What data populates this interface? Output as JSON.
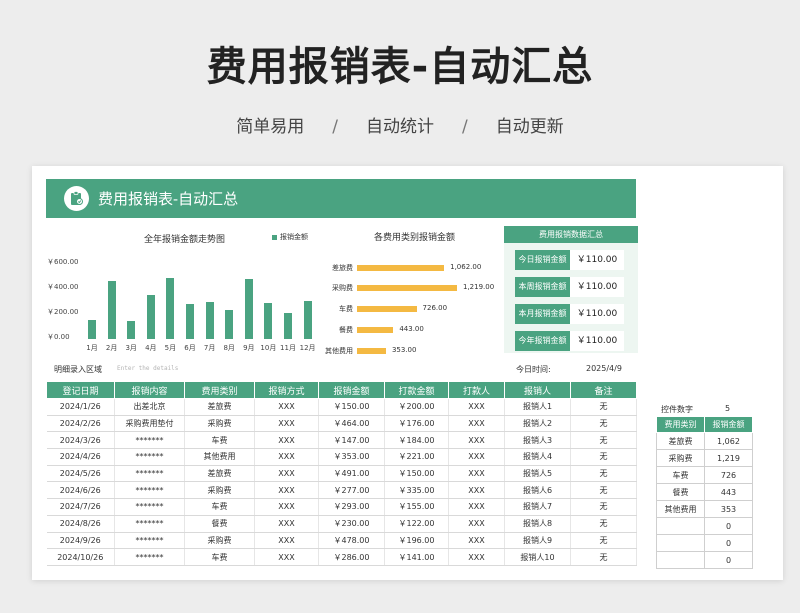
{
  "hero": {
    "title": "费用报销表-自动汇总",
    "tags": [
      "简单易用",
      "自动统计",
      "自动更新"
    ],
    "separator": "/"
  },
  "banner": {
    "title": "费用报销表-自动汇总"
  },
  "colors": {
    "accent": "#4aa381",
    "bar_h": "#f4b942"
  },
  "chart_data": [
    {
      "type": "bar",
      "title": "全年报销金额走势图",
      "legend": [
        "报销金额"
      ],
      "categories": [
        "1月",
        "2月",
        "3月",
        "4月",
        "5月",
        "6月",
        "7月",
        "8月",
        "9月",
        "10月",
        "11月",
        "12月"
      ],
      "values": [
        150,
        464,
        147,
        353,
        491,
        277,
        293,
        230,
        478,
        286,
        206,
        304
      ],
      "yticks": [
        "￥600.00",
        "￥400.00",
        "￥200.00",
        "￥0.00"
      ],
      "ylim": [
        0,
        600
      ]
    },
    {
      "type": "bar",
      "orientation": "horizontal",
      "title": "各费用类别报销金额",
      "categories": [
        "差旅费",
        "采购费",
        "车费",
        "餐费",
        "其他费用"
      ],
      "values": [
        1062,
        1219,
        726,
        443,
        353
      ],
      "labels": [
        "1,062.00",
        "1,219.00",
        "726.00",
        "443.00",
        "353.00"
      ],
      "xlim": [
        0,
        1400
      ]
    }
  ],
  "summary": {
    "title": "费用报销数据汇总",
    "rows": [
      {
        "label": "今日报销金额",
        "value": "￥110.00"
      },
      {
        "label": "本周报销金额",
        "value": "￥110.00"
      },
      {
        "label": "本月报销金额",
        "value": "￥110.00"
      },
      {
        "label": "今年报销金额",
        "value": "￥110.00"
      }
    ]
  },
  "entry": {
    "label": "明细录入区域",
    "placeholder": "Enter the details",
    "today_label": "今日时间:",
    "today_value": "2025/4/9"
  },
  "table": {
    "headers": [
      "登记日期",
      "报销内容",
      "费用类别",
      "报销方式",
      "报销金额",
      "打款金额",
      "打款人",
      "报销人",
      "备注"
    ],
    "rows": [
      [
        "2024/1/26",
        "出差北京",
        "差旅费",
        "XXX",
        "￥150.00",
        "￥200.00",
        "XXX",
        "报销人1",
        "无"
      ],
      [
        "2024/2/26",
        "采购费用垫付",
        "采购费",
        "XXX",
        "￥464.00",
        "￥176.00",
        "XXX",
        "报销人2",
        "无"
      ],
      [
        "2024/3/26",
        "*******",
        "车费",
        "XXX",
        "￥147.00",
        "￥184.00",
        "XXX",
        "报销人3",
        "无"
      ],
      [
        "2024/4/26",
        "*******",
        "其他费用",
        "XXX",
        "￥353.00",
        "￥221.00",
        "XXX",
        "报销人4",
        "无"
      ],
      [
        "2024/5/26",
        "*******",
        "差旅费",
        "XXX",
        "￥491.00",
        "￥150.00",
        "XXX",
        "报销人5",
        "无"
      ],
      [
        "2024/6/26",
        "*******",
        "采购费",
        "XXX",
        "￥277.00",
        "￥335.00",
        "XXX",
        "报销人6",
        "无"
      ],
      [
        "2024/7/26",
        "*******",
        "车费",
        "XXX",
        "￥293.00",
        "￥155.00",
        "XXX",
        "报销人7",
        "无"
      ],
      [
        "2024/8/26",
        "*******",
        "餐费",
        "XXX",
        "￥230.00",
        "￥122.00",
        "XXX",
        "报销人8",
        "无"
      ],
      [
        "2024/9/26",
        "*******",
        "采购费",
        "XXX",
        "￥478.00",
        "￥196.00",
        "XXX",
        "报销人9",
        "无"
      ],
      [
        "2024/10/26",
        "*******",
        "车费",
        "XXX",
        "￥286.00",
        "￥141.00",
        "XXX",
        "报销人10",
        "无"
      ]
    ]
  },
  "control": {
    "label": "控件数字",
    "value": "5"
  },
  "side_table": {
    "headers": [
      "费用类别",
      "报销金额"
    ],
    "rows": [
      [
        "差旅费",
        "1,062"
      ],
      [
        "采购费",
        "1,219"
      ],
      [
        "车费",
        "726"
      ],
      [
        "餐费",
        "443"
      ],
      [
        "其他费用",
        "353"
      ],
      [
        "",
        "0"
      ],
      [
        "",
        "0"
      ],
      [
        "",
        "0"
      ]
    ]
  }
}
